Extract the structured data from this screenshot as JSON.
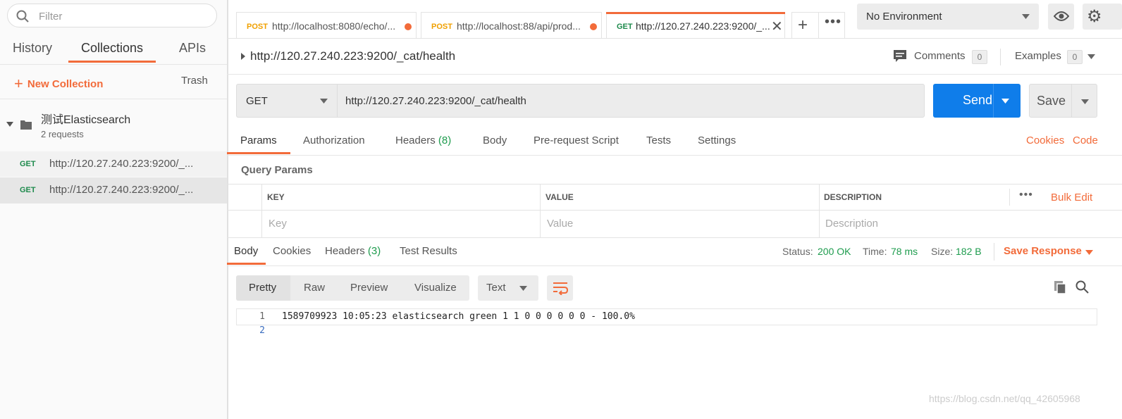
{
  "sidebar": {
    "filter_placeholder": "Filter",
    "tabs": [
      "History",
      "Collections",
      "APIs"
    ],
    "active_tab": "Collections",
    "new_collection": "New Collection",
    "trash": "Trash",
    "collection": {
      "name": "测试Elasticsearch",
      "count": "2 requests"
    },
    "requests": [
      {
        "method": "GET",
        "url": "http://120.27.240.223:9200/_...",
        "selected": false
      },
      {
        "method": "GET",
        "url": "http://120.27.240.223:9200/_...",
        "selected": true
      }
    ]
  },
  "tabs": [
    {
      "method": "POST",
      "url": "http://localhost:8080/echo/...",
      "method_color": "#f0a000",
      "unsaved": true
    },
    {
      "method": "POST",
      "url": "http://localhost:88/api/prod...",
      "method_color": "#f0a000",
      "unsaved": true
    },
    {
      "method": "GET",
      "url": "http://120.27.240.223:9200/_...",
      "method_color": "#1e8a4c",
      "active": true
    }
  ],
  "environment": {
    "selected": "No Environment"
  },
  "request": {
    "title": "http://120.27.240.223:9200/_cat/health",
    "comments_label": "Comments",
    "comments_count": "0",
    "examples_label": "Examples",
    "examples_count": "0",
    "method": "GET",
    "url": "http://120.27.240.223:9200/_cat/health",
    "send_label": "Send",
    "save_label": "Save"
  },
  "request_tabs": {
    "params": "Params",
    "authorization": "Authorization",
    "headers": "Headers",
    "headers_count": "(8)",
    "body": "Body",
    "prerequest": "Pre-request Script",
    "tests": "Tests",
    "settings": "Settings",
    "cookies": "Cookies",
    "code": "Code"
  },
  "query_params": {
    "title": "Query Params",
    "headers": {
      "key": "KEY",
      "value": "VALUE",
      "description": "DESCRIPTION"
    },
    "bulk_edit": "Bulk Edit",
    "placeholders": {
      "key": "Key",
      "value": "Value",
      "description": "Description"
    }
  },
  "response": {
    "tabs": {
      "body": "Body",
      "cookies": "Cookies",
      "headers": "Headers",
      "headers_count": "(3)",
      "test_results": "Test Results"
    },
    "status_label": "Status:",
    "status_value": "200 OK",
    "time_label": "Time:",
    "time_value": "78 ms",
    "size_label": "Size:",
    "size_value": "182 B",
    "save_response": "Save Response",
    "formats": [
      "Pretty",
      "Raw",
      "Preview",
      "Visualize"
    ],
    "text_type": "Text",
    "lines": [
      {
        "n": "1",
        "text": "1589709923 10:05:23 elasticsearch green 1 1 0 0 0 0 0 0 - 100.0%"
      },
      {
        "n": "2",
        "text": ""
      }
    ]
  },
  "watermark": "https://blog.csdn.net/qq_42605968",
  "colors": {
    "accent": "#f26b3a",
    "send": "#0f7dea",
    "get": "#1e8a4c",
    "post": "#f0a000",
    "status_ok": "#1e9c4e"
  }
}
